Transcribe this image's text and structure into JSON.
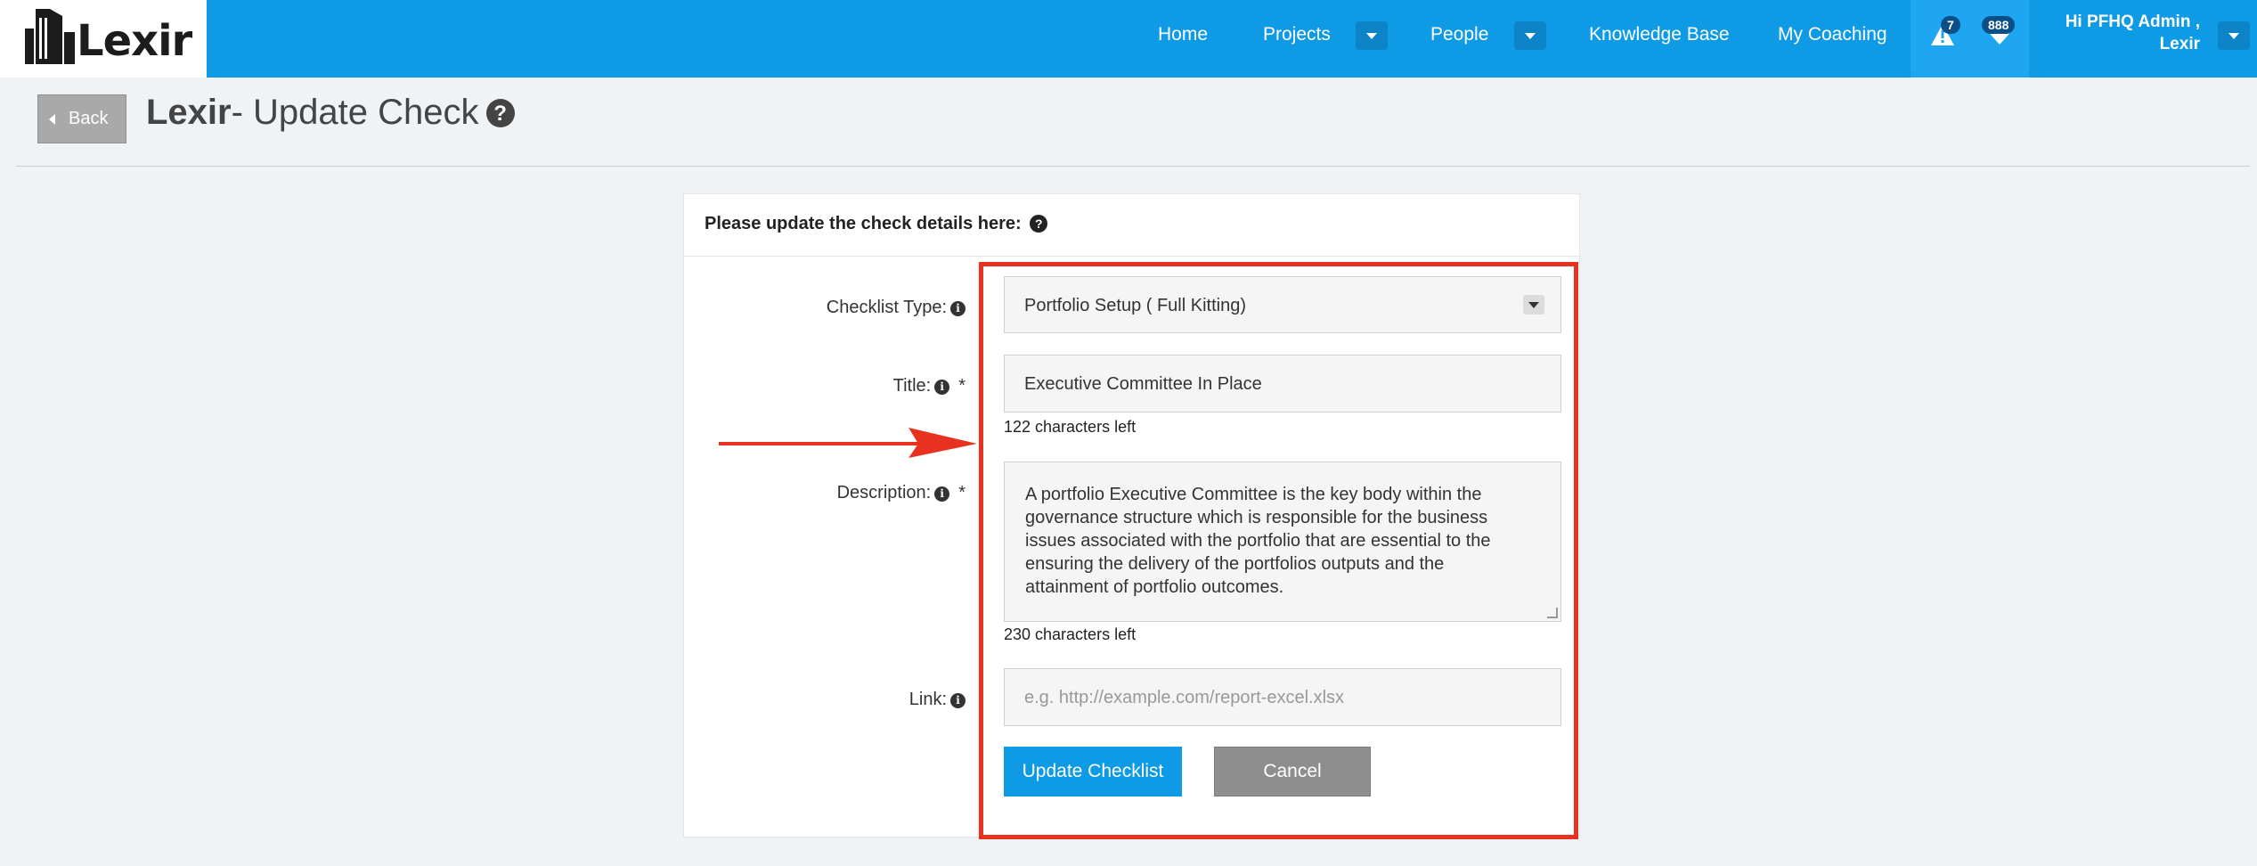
{
  "nav": {
    "brand": "Lexir",
    "items": [
      "Home",
      "Projects",
      "People",
      "Knowledge Base",
      "My Coaching"
    ],
    "alerts_count": "7",
    "messages_count": "888",
    "user_greeting_line1": "Hi PFHQ Admin ,",
    "user_greeting_line2": "Lexir"
  },
  "header": {
    "back_label": "Back",
    "title_bold": "Lexir",
    "title_rest": "- Update Check",
    "help_glyph": "?"
  },
  "form": {
    "card_title": "Please update the check details here:",
    "card_help": "?",
    "checklist_type_label": "Checklist Type:",
    "checklist_type_value": "Portfolio Setup ( Full Kitting)",
    "title_label": "Title:",
    "title_value": "Executive Committee In Place",
    "title_chars_left": "122 characters left",
    "description_label": "Description:",
    "description_value": "A portfolio Executive Committee is the key body within the governance structure which is responsible for the business issues associated with the portfolio that are essential to the ensuring the delivery of the portfolios outputs and the attainment of portfolio outcomes.",
    "description_lines": [
      "A portfolio Executive Committee is the key body within the",
      "governance structure which is responsible for the business",
      "issues associated with the portfolio that are essential to the",
      "ensuring the delivery of the portfolios outputs and the",
      "attainment of portfolio outcomes."
    ],
    "description_chars_left": "230 characters left",
    "link_label": "Link:",
    "link_placeholder": "e.g. http://example.com/report-excel.xlsx",
    "required_mark": "*",
    "info_glyph": "i",
    "submit_label": "Update Checklist",
    "cancel_label": "Cancel"
  },
  "colors": {
    "navbar": "#0f9ae6",
    "primary_button": "#0f9ae6",
    "annotation": "#e8321f"
  }
}
